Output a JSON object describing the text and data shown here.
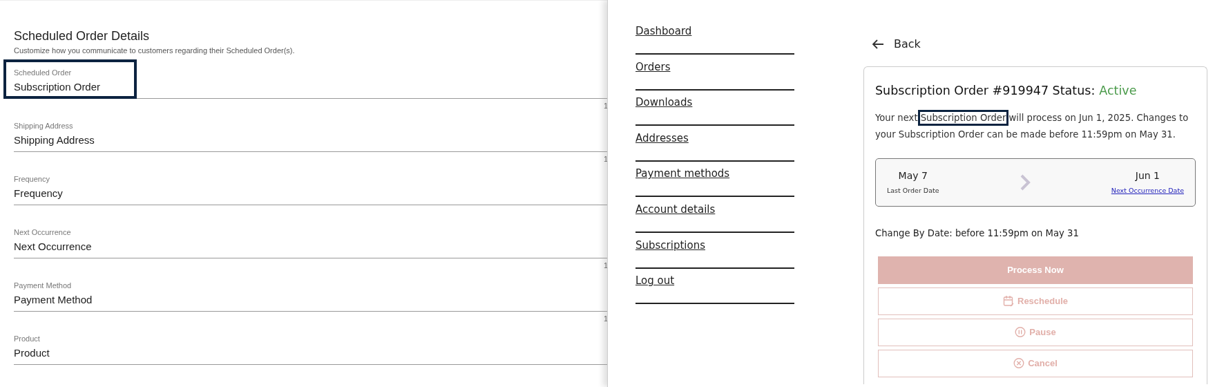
{
  "settings": {
    "title": "Scheduled Order Details",
    "subtitle": "Customize how you communicate to customers regarding their Scheduled Order(s).",
    "fields": [
      {
        "label": "Scheduled Order",
        "value": "Subscription Order",
        "highlighted": true,
        "counter": "1"
      },
      {
        "label": "Shipping Address",
        "value": "Shipping Address",
        "highlighted": false,
        "counter": "1"
      },
      {
        "label": "Frequency",
        "value": "Frequency",
        "highlighted": false
      },
      {
        "label": "Next Occurrence",
        "value": "Next Occurrence",
        "highlighted": false,
        "counter": "1"
      },
      {
        "label": "Payment Method",
        "value": "Payment Method",
        "highlighted": false,
        "counter": "1"
      },
      {
        "label": "Product",
        "value": "Product",
        "highlighted": false
      }
    ]
  },
  "preview": {
    "nav": [
      "Dashboard",
      "Orders",
      "Downloads",
      "Addresses",
      "Payment methods",
      "Account details",
      "Subscriptions",
      "Log out"
    ],
    "back": "Back",
    "card": {
      "title": "Subscription Order #919947 Status:",
      "status": "Active",
      "message": {
        "before": "Your next",
        "highlight": "Subscription Order",
        "after": "will process on Jun 1, 2025. Changes to your Subscription Order can be made before 11:59pm on May 31."
      },
      "last_date": {
        "value": "May 7",
        "label": "Last Order Date"
      },
      "next_date": {
        "value": "Jun 1",
        "label": "Next Occurrence Date"
      },
      "change_by": "Change By Date: before 11:59pm on May 31",
      "buttons": [
        {
          "label": "Process Now",
          "kind": "primary",
          "disabled": true
        },
        {
          "label": "Reschedule",
          "kind": "reschedule",
          "disabled": true
        },
        {
          "label": "Pause",
          "kind": "pause",
          "disabled": true
        },
        {
          "label": "Cancel",
          "kind": "cancel",
          "disabled": true
        }
      ]
    }
  }
}
